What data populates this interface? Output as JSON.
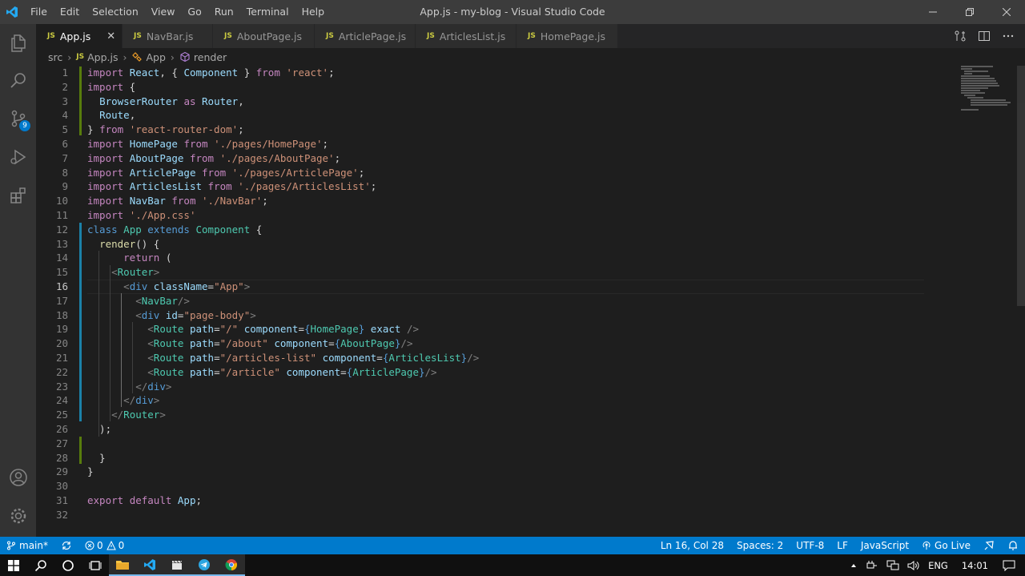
{
  "window": {
    "title": "App.js - my-blog - Visual Studio Code",
    "menu": [
      "File",
      "Edit",
      "Selection",
      "View",
      "Go",
      "Run",
      "Terminal",
      "Help"
    ]
  },
  "activity": {
    "scm_badge": "9"
  },
  "tabs": [
    {
      "label": "App.js",
      "icon": "JS",
      "active": true
    },
    {
      "label": "NavBar.js",
      "icon": "JS"
    },
    {
      "label": "AboutPage.js",
      "icon": "JS"
    },
    {
      "label": "ArticlePage.js",
      "icon": "JS"
    },
    {
      "label": "ArticlesList.js",
      "icon": "JS"
    },
    {
      "label": "HomePage.js",
      "icon": "JS"
    }
  ],
  "tab_close": "✕",
  "breadcrumb": {
    "folder": "src",
    "file_icon": "JS",
    "file": "App.js",
    "class": "App",
    "method": "render"
  },
  "editor": {
    "current_line": 16,
    "line_numbers": [
      "1",
      "2",
      "3",
      "4",
      "5",
      "6",
      "7",
      "8",
      "9",
      "10",
      "11",
      "12",
      "13",
      "14",
      "15",
      "16",
      "17",
      "18",
      "19",
      "20",
      "21",
      "22",
      "23",
      "24",
      "25",
      "26",
      "27",
      "28",
      "29",
      "30",
      "31",
      "32"
    ]
  },
  "statusbar": {
    "branch": "main*",
    "errors": "0",
    "warnings": "0",
    "position": "Ln 16, Col 28",
    "spaces": "Spaces: 2",
    "encoding": "UTF-8",
    "eol": "LF",
    "language": "JavaScript",
    "golive": "Go Live"
  },
  "taskbar": {
    "language": "ENG",
    "time": "14:01"
  },
  "colors": {
    "accent": "#007acc",
    "keyword": "#569cd6",
    "control": "#c586c0",
    "string": "#ce9178",
    "class": "#4ec9b0",
    "variable": "#9cdcfe"
  }
}
